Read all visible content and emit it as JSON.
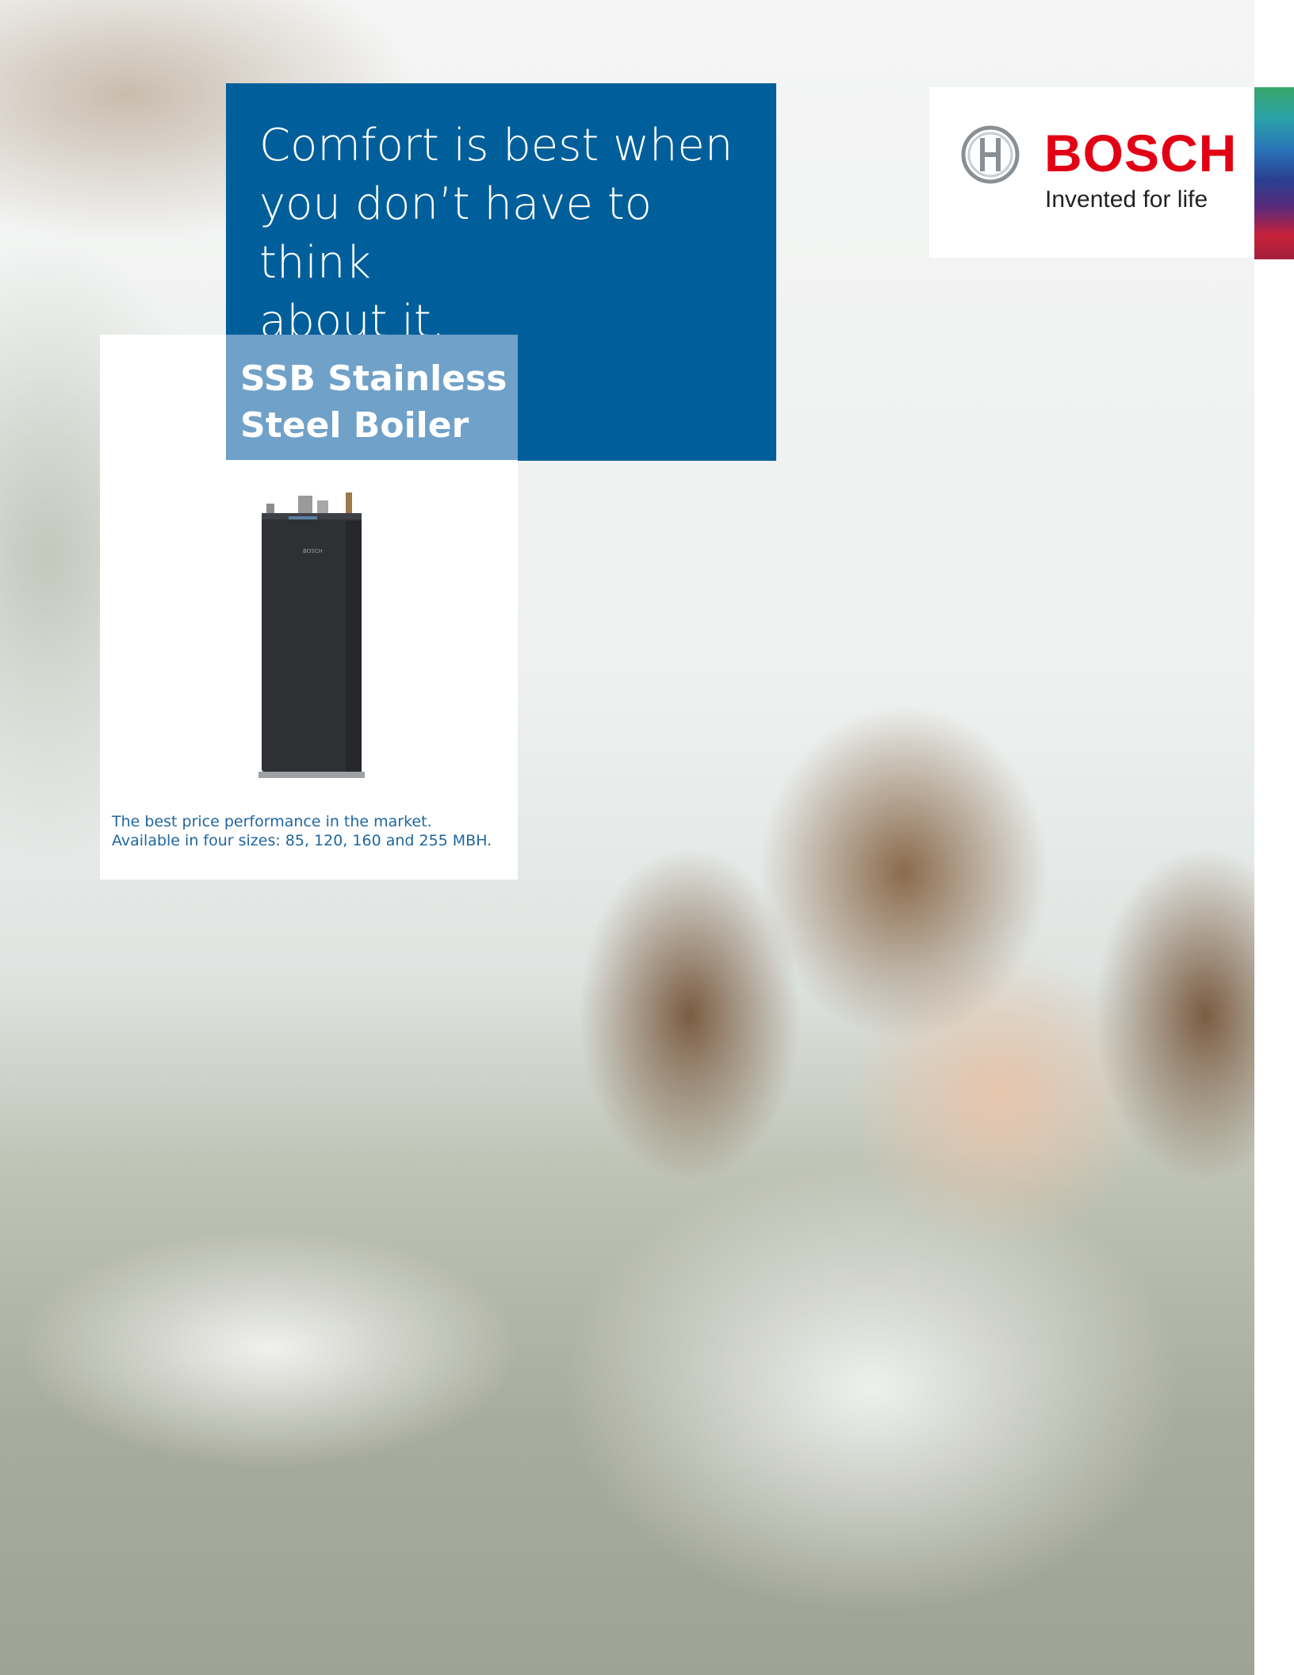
{
  "headline": {
    "lines": [
      "Comfort is best when",
      "you don’t have to think",
      "about it."
    ]
  },
  "brand": {
    "name": "BOSCH",
    "tagline": "Invented for life",
    "colors": {
      "red": "#e20015",
      "blue": "#005f9a",
      "light_blue": "#70a1c8"
    }
  },
  "product": {
    "title_lines": [
      "SSB Stainless",
      "Steel Boiler"
    ],
    "unit_label": "BOSCH",
    "description_lines": [
      "The best price performance in the market.",
      "Available in four sizes: 85, 120, 160 and 255 MBH."
    ]
  }
}
